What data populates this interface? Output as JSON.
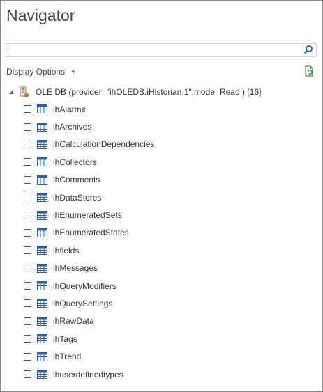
{
  "title": "Navigator",
  "search": {
    "value": "",
    "placeholder": ""
  },
  "display_options": {
    "label": "Display Options"
  },
  "tree": {
    "root_label": "OLE DB (provider=\"ihOLEDB.iHistorian.1\";mode=Read ) [16]",
    "items": [
      {
        "label": "ihAlarms"
      },
      {
        "label": "ihArchives"
      },
      {
        "label": "ihCalculationDependencies"
      },
      {
        "label": "ihCollectors"
      },
      {
        "label": "ihComments"
      },
      {
        "label": "ihDataStores"
      },
      {
        "label": "ihEnumeratedSets"
      },
      {
        "label": "ihEnumeratedStates"
      },
      {
        "label": "ihfields"
      },
      {
        "label": "ihMessages"
      },
      {
        "label": "ihQueryModifiers"
      },
      {
        "label": "ihQuerySettings"
      },
      {
        "label": "ihRawData"
      },
      {
        "label": "ihTags"
      },
      {
        "label": "ihTrend"
      },
      {
        "label": "ihuserdefinedtypes"
      }
    ]
  },
  "icons": {
    "search": "search-icon",
    "refresh": "refresh-page-icon",
    "database": "database-icon",
    "table": "table-icon",
    "expand": "expand-arrow-icon",
    "dropdown": "chevron-down-icon"
  },
  "colors": {
    "border": "#8a8a8a",
    "table_icon_blue": "#2f5da7",
    "accent_orange": "#d9822b",
    "text": "#333333"
  }
}
